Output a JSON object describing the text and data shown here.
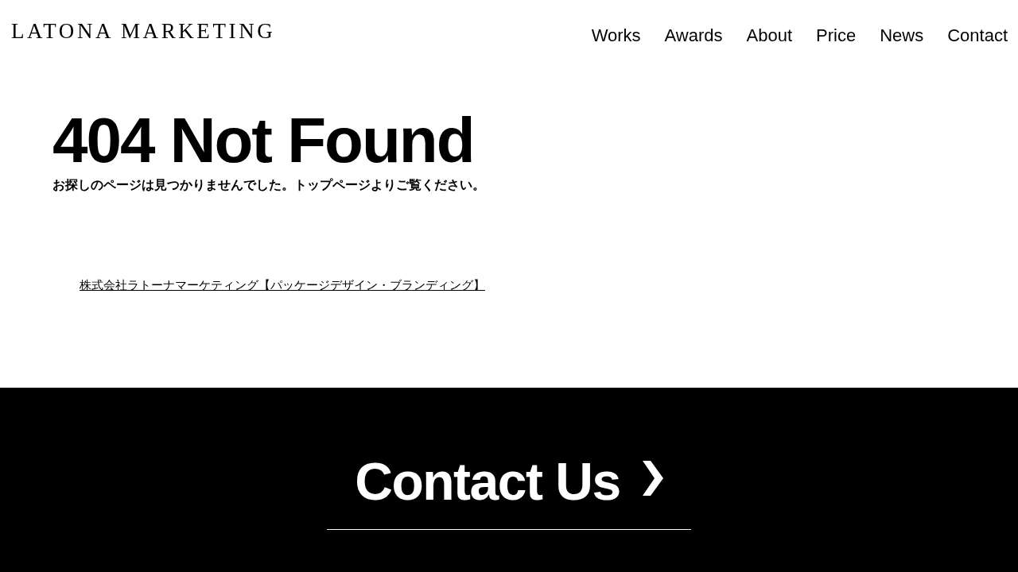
{
  "header": {
    "logo": "LATONA MARKETING",
    "nav": [
      "Works",
      "Awards",
      "About",
      "Price",
      "News",
      "Contact"
    ]
  },
  "main": {
    "title": "404 Not Found",
    "message": "お探しのページは見つかりませんでした。トップページよりご覧ください。",
    "home_link": "株式会社ラトーナマーケティング【パッケージデザイン・ブランディング】"
  },
  "footer": {
    "contact_link": "Contact Us"
  }
}
